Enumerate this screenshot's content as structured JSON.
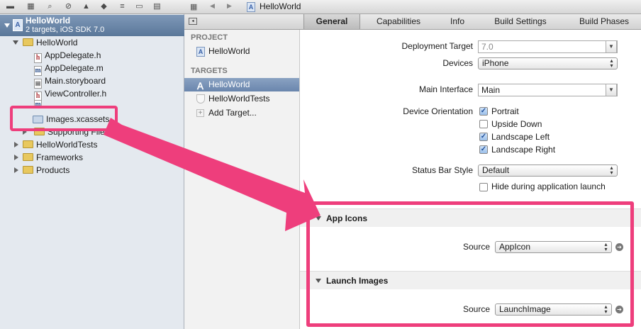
{
  "navigator": {
    "project": {
      "title": "HelloWorld",
      "subtitle": "2 targets, iOS SDK 7.0"
    },
    "tree": [
      {
        "label": "HelloWorld",
        "kind": "folder"
      },
      {
        "label": "AppDelegate.h",
        "kind": "h"
      },
      {
        "label": "AppDelegate.m",
        "kind": "m"
      },
      {
        "label": "Main.storyboard",
        "kind": "storyboard"
      },
      {
        "label": "ViewController.h",
        "kind": "h"
      },
      {
        "label": "Images.xcassets",
        "kind": "xcassets"
      },
      {
        "label": "Supporting Files",
        "kind": "folder"
      },
      {
        "label": "HelloWorldTests",
        "kind": "folder"
      },
      {
        "label": "Frameworks",
        "kind": "folder"
      },
      {
        "label": "Products",
        "kind": "folder"
      }
    ]
  },
  "jumpbar": {
    "title": "HelloWorld"
  },
  "tabs": [
    {
      "label": "General"
    },
    {
      "label": "Capabilities"
    },
    {
      "label": "Info"
    },
    {
      "label": "Build Settings"
    },
    {
      "label": "Build Phases"
    }
  ],
  "targets_panel": {
    "project_header": "PROJECT",
    "project_item": "HelloWorld",
    "targets_header": "TARGETS",
    "target_items": [
      "HelloWorld",
      "HelloWorldTests"
    ],
    "add_target": "Add Target..."
  },
  "settings": {
    "deployment_target": {
      "label": "Deployment Target",
      "value": "7.0"
    },
    "devices": {
      "label": "Devices",
      "value": "iPhone"
    },
    "main_interface": {
      "label": "Main Interface",
      "value": "Main"
    },
    "orientation": {
      "label": "Device Orientation",
      "options": [
        {
          "label": "Portrait",
          "checked": true
        },
        {
          "label": "Upside Down",
          "checked": false
        },
        {
          "label": "Landscape Left",
          "checked": true
        },
        {
          "label": "Landscape Right",
          "checked": true
        }
      ]
    },
    "status_bar_style": {
      "label": "Status Bar Style",
      "value": "Default"
    },
    "hide_status_bar": {
      "label": "Hide during application launch",
      "checked": false
    },
    "app_icons": {
      "title": "App Icons",
      "source_label": "Source",
      "source_value": "AppIcon"
    },
    "launch_images": {
      "title": "Launch Images",
      "source_label": "Source",
      "source_value": "LaunchImage"
    }
  },
  "colors": {
    "highlight": "#ee3e7c",
    "selection": "#6a86ad"
  }
}
